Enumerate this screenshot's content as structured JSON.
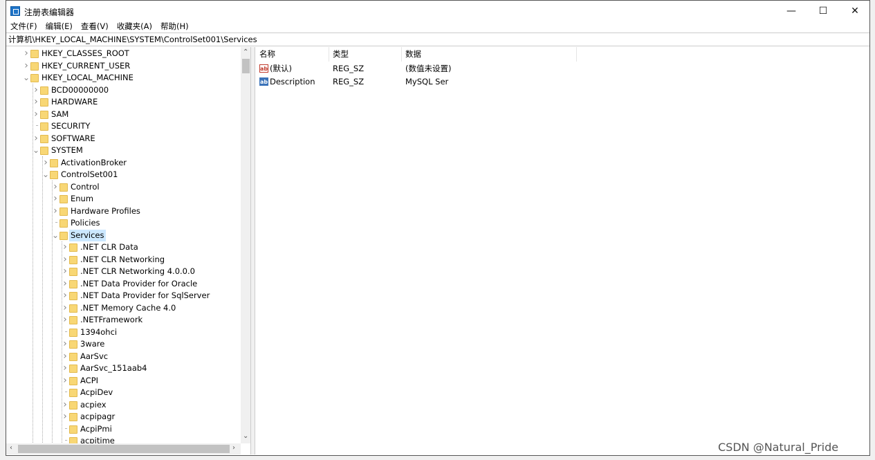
{
  "window": {
    "title": "注册表编辑器",
    "minimize": "—",
    "maximize": "☐",
    "close": "✕"
  },
  "menu": [
    "文件(F)",
    "编辑(E)",
    "查看(V)",
    "收藏夹(A)",
    "帮助(H)"
  ],
  "address": "计算机\\HKEY_LOCAL_MACHINE\\SYSTEM\\ControlSet001\\Services",
  "tree": [
    {
      "label": "HKEY_CLASSES_ROOT",
      "level": 0,
      "state": "collapsed"
    },
    {
      "label": "HKEY_CURRENT_USER",
      "level": 0,
      "state": "collapsed"
    },
    {
      "label": "HKEY_LOCAL_MACHINE",
      "level": 0,
      "state": "expanded"
    },
    {
      "label": "BCD00000000",
      "level": 1,
      "state": "collapsed"
    },
    {
      "label": "HARDWARE",
      "level": 1,
      "state": "collapsed"
    },
    {
      "label": "SAM",
      "level": 1,
      "state": "collapsed"
    },
    {
      "label": "SECURITY",
      "level": 1,
      "state": "leaf"
    },
    {
      "label": "SOFTWARE",
      "level": 1,
      "state": "collapsed"
    },
    {
      "label": "SYSTEM",
      "level": 1,
      "state": "expanded"
    },
    {
      "label": "ActivationBroker",
      "level": 2,
      "state": "collapsed"
    },
    {
      "label": "ControlSet001",
      "level": 2,
      "state": "expanded"
    },
    {
      "label": "Control",
      "level": 3,
      "state": "collapsed"
    },
    {
      "label": "Enum",
      "level": 3,
      "state": "collapsed"
    },
    {
      "label": "Hardware Profiles",
      "level": 3,
      "state": "collapsed"
    },
    {
      "label": "Policies",
      "level": 3,
      "state": "leaf"
    },
    {
      "label": "Services",
      "level": 3,
      "state": "expanded",
      "selected": true
    },
    {
      "label": ".NET CLR Data",
      "level": 4,
      "state": "collapsed"
    },
    {
      "label": ".NET CLR Networking",
      "level": 4,
      "state": "collapsed"
    },
    {
      "label": ".NET CLR Networking 4.0.0.0",
      "level": 4,
      "state": "collapsed"
    },
    {
      "label": ".NET Data Provider for Oracle",
      "level": 4,
      "state": "collapsed"
    },
    {
      "label": ".NET Data Provider for SqlServer",
      "level": 4,
      "state": "collapsed"
    },
    {
      "label": ".NET Memory Cache 4.0",
      "level": 4,
      "state": "collapsed"
    },
    {
      "label": ".NETFramework",
      "level": 4,
      "state": "collapsed"
    },
    {
      "label": "1394ohci",
      "level": 4,
      "state": "leaf"
    },
    {
      "label": "3ware",
      "level": 4,
      "state": "collapsed"
    },
    {
      "label": "AarSvc",
      "level": 4,
      "state": "collapsed"
    },
    {
      "label": "AarSvc_151aab4",
      "level": 4,
      "state": "collapsed"
    },
    {
      "label": "ACPI",
      "level": 4,
      "state": "collapsed"
    },
    {
      "label": "AcpiDev",
      "level": 4,
      "state": "leaf"
    },
    {
      "label": "acpiex",
      "level": 4,
      "state": "collapsed"
    },
    {
      "label": "acpipagr",
      "level": 4,
      "state": "collapsed"
    },
    {
      "label": "AcpiPmi",
      "level": 4,
      "state": "leaf"
    },
    {
      "label": "acpitime",
      "level": 4,
      "state": "leaf"
    }
  ],
  "columns": {
    "name": "名称",
    "type": "类型",
    "data": "数据"
  },
  "values": [
    {
      "name": "(默认)",
      "type": "REG_SZ",
      "data": "(数值未设置)",
      "icon": "string-value-icon",
      "color": "#c0392b"
    },
    {
      "name": "Description",
      "type": "REG_SZ",
      "data": "MySQL Ser",
      "icon": "string-value-icon",
      "color": "#3b73b9"
    }
  ],
  "watermark": "CSDN @Natural_Pride"
}
